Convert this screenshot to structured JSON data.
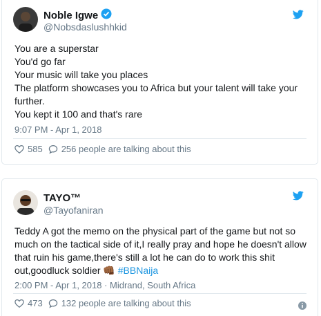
{
  "colors": {
    "link": "#1b95e0",
    "twitter_blue": "#1da1f2",
    "muted": "#657786",
    "text": "#14171a",
    "border": "#e1e8ed"
  },
  "tweets": [
    {
      "author": {
        "name": "Noble Igwe",
        "handle": "@Nobsdaslushhkid",
        "verified": true,
        "avatar_icon": "avatar-photo"
      },
      "lines": [
        "You are a superstar",
        "You'd go far",
        "Your music will take you places",
        "The platform showcases you to Africa but your talent will take your",
        "further.",
        "You kept it 100 and that's rare"
      ],
      "timestamp": "9:07 PM - Apr 1, 2018",
      "likes": "585",
      "talking": "256 people are talking about this"
    },
    {
      "author": {
        "name": "TAYO™",
        "handle": "@Tayofaniran",
        "verified": false,
        "avatar_icon": "avatar-photo"
      },
      "lines": [
        "Teddy A got the memo on the physical part of the game but not so",
        "much on the tactical side of it,I really pray and hope he doesn't allow",
        "that ruin his game,there's still a lot he can do to work this shit",
        "out,goodluck soldier"
      ],
      "emoji": "👊🏾",
      "hashtag": "#BBNaija",
      "timestamp": "2:00 PM - Apr 1, 2018 · Midrand, South Africa",
      "likes": "473",
      "talking": "132 people are talking about this"
    }
  ]
}
